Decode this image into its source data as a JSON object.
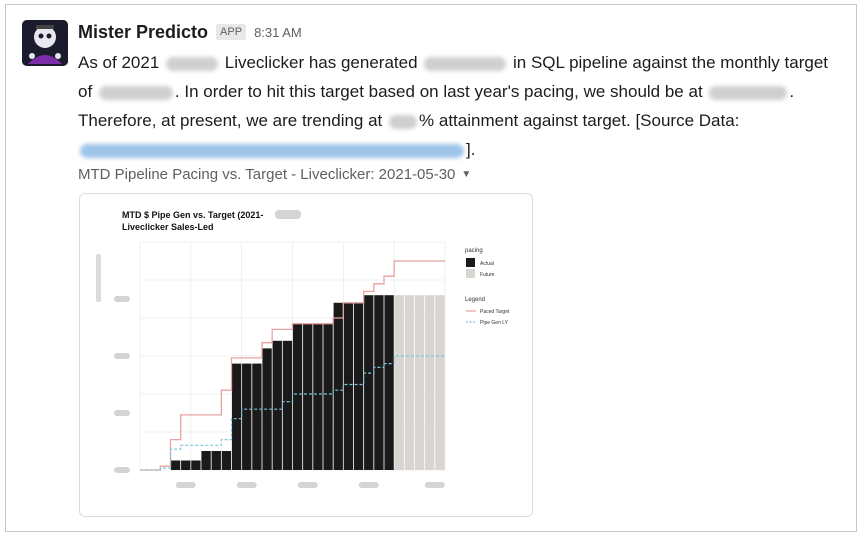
{
  "message": {
    "sender": "Mister Predicto",
    "badge": "APP",
    "time": "8:31 AM",
    "text": {
      "p1": "As of 2021",
      "p2": "Liveclicker has generated",
      "p3": "in SQL pipeline against the monthly",
      "p4": "target of",
      "p5": "In order to hit this target based on last year's pacing, we should be at",
      "p6": ". Therefore, at present, we are trending at",
      "p7": "% attainment against target.",
      "p8": "[Source Data:",
      "p9": "]."
    }
  },
  "attachment": {
    "title": "MTD Pipeline Pacing vs. Target - Liveclicker: 2021-05-30",
    "icon": "caret-down-icon"
  },
  "chart_data": {
    "type": "bar",
    "title": "MTD $ Pipe Gen vs. Target (2021-",
    "subtitle": "Liveclicker Sales-Led",
    "legend_pacing_title": "pacing",
    "legend_pacing": [
      "Actual",
      "Future"
    ],
    "legend_lines_title": "Legend",
    "legend_lines": [
      "Paced Target",
      "Pipe Gen LY"
    ],
    "x": [
      1,
      2,
      3,
      4,
      5,
      6,
      7,
      8,
      9,
      10,
      11,
      12,
      13,
      14,
      15,
      16,
      17,
      18,
      19,
      20,
      21,
      22,
      23,
      24,
      25,
      26,
      27,
      28,
      29,
      30
    ],
    "actual": [
      0,
      0,
      0,
      0.5,
      0.5,
      0.5,
      1,
      1,
      1,
      5.6,
      5.6,
      5.6,
      6.4,
      6.8,
      6.8,
      7.7,
      7.7,
      7.7,
      7.7,
      8.8,
      8.8,
      8.8,
      9.2,
      9.2,
      9.2,
      null,
      null,
      null,
      null,
      null
    ],
    "future": [
      null,
      null,
      null,
      null,
      null,
      null,
      null,
      null,
      null,
      null,
      null,
      null,
      null,
      null,
      null,
      null,
      null,
      null,
      null,
      null,
      null,
      null,
      null,
      null,
      null,
      9.2,
      9.2,
      9.2,
      9.2,
      9.2
    ],
    "paced_target": [
      0,
      0,
      0.2,
      1.6,
      2.9,
      2.9,
      2.9,
      2.9,
      4.2,
      5.9,
      5.9,
      5.9,
      6.7,
      7.4,
      7.4,
      7.7,
      7.7,
      7.7,
      7.7,
      8.0,
      8.8,
      8.8,
      9.4,
      9.8,
      10.2,
      11.0,
      11.0,
      11.0,
      11.0,
      11.0
    ],
    "pipe_gen_ly": [
      0,
      0,
      0.1,
      1.1,
      1.3,
      1.3,
      1.3,
      1.3,
      1.6,
      2.7,
      3.2,
      3.2,
      3.2,
      3.2,
      3.6,
      4.0,
      4.0,
      4.0,
      4.0,
      4.2,
      4.5,
      4.5,
      5.1,
      5.4,
      5.6,
      6.0,
      6.0,
      6.0,
      6.0,
      6.0
    ],
    "ylim": [
      0,
      12
    ],
    "grid": true,
    "colors": {
      "actual": "#1a1a1a",
      "future": "#d9d6d2",
      "paced_target": "#e8a3a0",
      "pipe_gen_ly": "#7ec4db"
    }
  }
}
